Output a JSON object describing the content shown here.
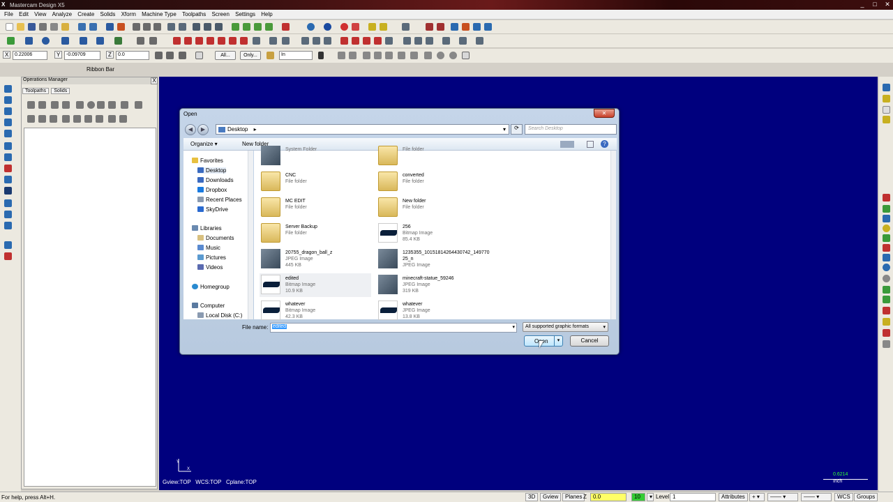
{
  "app": {
    "title": "Mastercam Design X5",
    "logo": "X"
  },
  "window_controls": {
    "min": "_",
    "max": "□",
    "close": "✕"
  },
  "menu": [
    "File",
    "Edit",
    "View",
    "Analyze",
    "Create",
    "Solids",
    "Xform",
    "Machine Type",
    "Toolpaths",
    "Screen",
    "Settings",
    "Help"
  ],
  "ribbon": {
    "x_label": "X",
    "x_value": "0.22006",
    "y_label": "Y",
    "y_value": "-0.09709",
    "z_label": "Z",
    "z_value": "0.0",
    "all_label": "All...",
    "only_label": "Only...",
    "select_mode": "In",
    "ribbon_bar_label": "Ribbon Bar"
  },
  "ops_manager": {
    "title": "Operations Manager",
    "tabs": [
      "Toolpaths",
      "Solids"
    ],
    "close": "X"
  },
  "viewport": {
    "view_info": "Gview:TOP   WCS:TOP   Cplane:TOP",
    "scale_value": "0.6214",
    "scale_unit": "Inch",
    "axis_y": "Y",
    "axis_x": "X"
  },
  "status": {
    "help": "For help, press Alt+H.",
    "mode_3d": "3D",
    "gview": "Gview",
    "planes": "Planes",
    "z_label": "Z",
    "z_value": "0.0",
    "color_value": "10",
    "level_label": "Level",
    "level_value": "1",
    "attributes": "Attributes",
    "wcs": "WCS",
    "groups": "Groups"
  },
  "dialog": {
    "title": "Open",
    "close": "✕",
    "back": "◀",
    "forward": "▶",
    "address": "Desktop",
    "address_arrow": "▸",
    "search_placeholder": "Search Desktop",
    "organize": "Organize ▾",
    "new_folder": "New folder",
    "help": "?",
    "nav": {
      "favorites": "Favorites",
      "desktop": "Desktop",
      "downloads": "Downloads",
      "dropbox": "Dropbox",
      "recent": "Recent Places",
      "skydrive": "SkyDrive",
      "libraries": "Libraries",
      "documents": "Documents",
      "music": "Music",
      "pictures": "Pictures",
      "videos": "Videos",
      "homegroup": "Homegroup",
      "computer": "Computer",
      "local_disk": "Local Disk (C:)"
    },
    "files_col1": [
      {
        "name": "",
        "type": "System Folder",
        "size": "",
        "kind": "system"
      },
      {
        "name": "CNC",
        "type": "File folder",
        "size": "",
        "kind": "folder"
      },
      {
        "name": "MC EDIT",
        "type": "File folder",
        "size": "",
        "kind": "folder"
      },
      {
        "name": "Server Backup",
        "type": "File folder",
        "size": "",
        "kind": "folder"
      },
      {
        "name": "20755_dragon_ball_z",
        "type": "JPEG Image",
        "size": "445 KB",
        "kind": "jpg"
      },
      {
        "name": "edited",
        "type": "Bitmap Image",
        "size": "10.9 KB",
        "kind": "bmp"
      },
      {
        "name": "whatever",
        "type": "Bitmap Image",
        "size": "42.3 KB",
        "kind": "bmp"
      }
    ],
    "files_col2": [
      {
        "name": "",
        "type": "File folder",
        "size": "",
        "kind": "folder"
      },
      {
        "name": "converted",
        "type": "File folder",
        "size": "",
        "kind": "folder"
      },
      {
        "name": "New folder",
        "type": "File folder",
        "size": "",
        "kind": "folder"
      },
      {
        "name": "256",
        "type": "Bitmap Image",
        "size": "85.4 KB",
        "kind": "bmp"
      },
      {
        "name": "1235355_10151814264430742_14977025_n",
        "type": "JPEG Image",
        "size": "",
        "kind": "jpg"
      },
      {
        "name": "minecraft-statue_59246",
        "type": "JPEG Image",
        "size": "319 KB",
        "kind": "jpg"
      },
      {
        "name": "whatever",
        "type": "JPEG Image",
        "size": "13.8 KB",
        "kind": "bmp"
      }
    ],
    "file_name_label": "File name:",
    "file_name_value": "edited",
    "file_type": "All supported graphic formats",
    "open": "Open",
    "cancel": "Cancel"
  },
  "colors": {
    "viewport": "#00007e",
    "dialog_frame": "#c5d5e9"
  }
}
